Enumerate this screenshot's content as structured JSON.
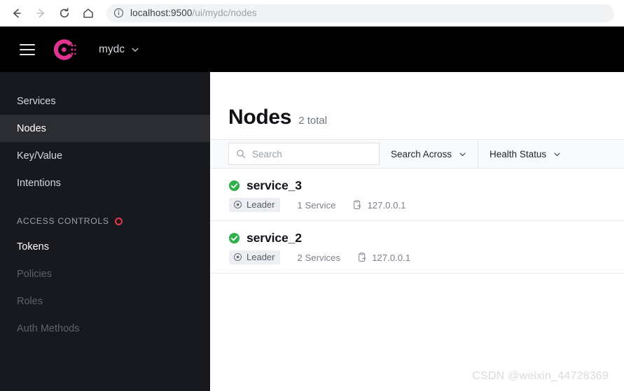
{
  "browser": {
    "back_icon": "arrow-left-icon",
    "forward_icon": "arrow-right-icon",
    "reload_icon": "reload-icon",
    "home_icon": "home-icon",
    "info_icon": "info-circle-icon",
    "url_host": "localhost:9500",
    "url_path": "/ui/mydc/nodes"
  },
  "topnav": {
    "menu_icon": "hamburger-menu-icon",
    "logo_icon": "consul-logo-icon",
    "datacenter_label": "mydc",
    "datacenter_caret_icon": "chevron-down-icon",
    "brand_color": "#e0328f",
    "background_color": "#000000"
  },
  "sidebar": {
    "background_color": "#17191f",
    "active_background_color": "#2b2d33",
    "items": [
      {
        "label": "Services",
        "state": "normal"
      },
      {
        "label": "Nodes",
        "state": "active"
      },
      {
        "label": "Key/Value",
        "state": "normal"
      },
      {
        "label": "Intentions",
        "state": "normal"
      }
    ],
    "section": {
      "label": "ACCESS CONTROLS",
      "status_icon": "red-dot-icon",
      "status_color": "#d63c4c"
    },
    "acl_items": [
      {
        "label": "Tokens",
        "state": "bright"
      },
      {
        "label": "Policies",
        "state": "disabled"
      },
      {
        "label": "Roles",
        "state": "disabled"
      },
      {
        "label": "Auth Methods",
        "state": "disabled"
      }
    ]
  },
  "main": {
    "title": "Nodes",
    "count_label": "2 total",
    "filters": {
      "search_icon": "search-icon",
      "search_value": "",
      "search_placeholder": "Search",
      "search_across_label": "Search Across",
      "search_across_caret_icon": "chevron-down-icon",
      "health_status_label": "Health Status",
      "health_status_caret_icon": "chevron-down-icon"
    },
    "nodes": [
      {
        "status_icon": "check-circle-icon",
        "status_color": "#2eb14a",
        "name": "service_3",
        "leader_icon": "target-dot-icon",
        "leader_label": "Leader",
        "services_label": "1 Service",
        "address_icon": "copy-clipboard-icon",
        "address": "127.0.0.1"
      },
      {
        "status_icon": "check-circle-icon",
        "status_color": "#2eb14a",
        "name": "service_2",
        "leader_icon": "target-dot-icon",
        "leader_label": "Leader",
        "services_label": "2 Services",
        "address_icon": "copy-clipboard-icon",
        "address": "127.0.0.1"
      }
    ]
  },
  "watermark": {
    "text": "CSDN @weixin_44728369"
  }
}
